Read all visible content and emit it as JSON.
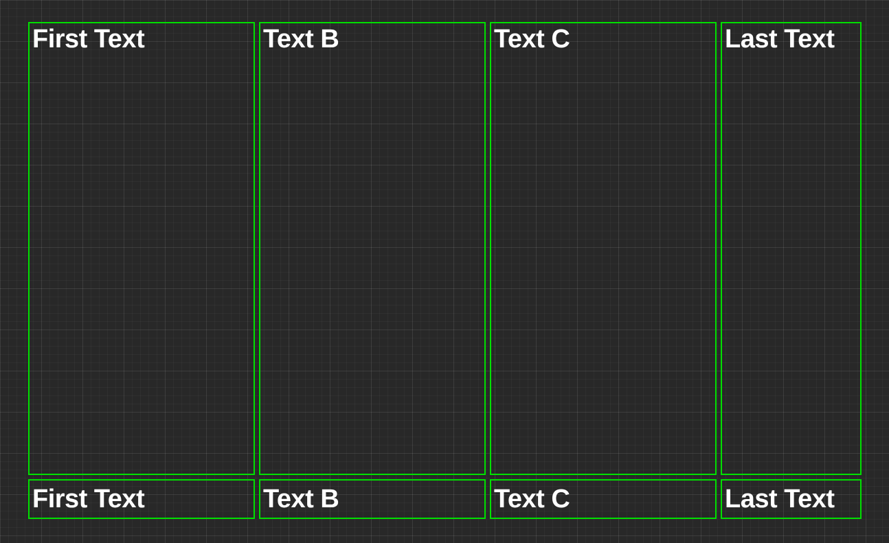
{
  "grid": {
    "topRow": {
      "cells": [
        {
          "label": "First Text"
        },
        {
          "label": "Text B"
        },
        {
          "label": "Text C"
        },
        {
          "label": "Last Text"
        }
      ]
    },
    "bottomRow": {
      "cells": [
        {
          "label": "First Text"
        },
        {
          "label": "Text B"
        },
        {
          "label": "Text C"
        },
        {
          "label": "Last Text"
        }
      ]
    }
  },
  "colors": {
    "border": "#00e000",
    "text": "#ffffff",
    "background": "#282828"
  }
}
